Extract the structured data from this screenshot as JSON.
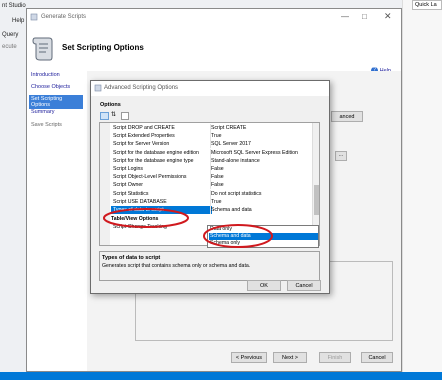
{
  "background_app": {
    "title_fragment": "nt Studio",
    "menu_help": "Help",
    "menu_query": "Query",
    "menu_execute": "ecute",
    "right_title": "Quick La"
  },
  "wizard": {
    "title": "Generate Scripts",
    "heading": "Set Scripting Options",
    "help": "Help",
    "nav": [
      {
        "label": "Introduction",
        "selected": false
      },
      {
        "label": "Choose Objects",
        "selected": false
      },
      {
        "label": "Set Scripting Options",
        "selected": true
      },
      {
        "label": "Summary",
        "selected": false
      },
      {
        "label": "Save Scripts",
        "selected": false
      }
    ],
    "advanced_button_fragment": "anced",
    "buttons": {
      "previous": "< Previous",
      "next": "Next >",
      "finish": "Finish",
      "cancel": "Cancel"
    }
  },
  "dialog": {
    "title": "Advanced Scripting Options",
    "options_label": "Options",
    "rows": [
      {
        "name": "Script DROP and CREATE",
        "value": "Script CREATE"
      },
      {
        "name": "Script Extended Properties",
        "value": "True"
      },
      {
        "name": "Script for Server Version",
        "value": "SQL Server 2017"
      },
      {
        "name": "Script for the database engine edition",
        "value": "Microsoft SQL Server Express Edition"
      },
      {
        "name": "Script for the database engine type",
        "value": "Stand-alone instance"
      },
      {
        "name": "Script Logins",
        "value": "False"
      },
      {
        "name": "Script Object-Level Permissions",
        "value": "False"
      },
      {
        "name": "Script Owner",
        "value": "False"
      },
      {
        "name": "Script Statistics",
        "value": "Do not script statistics"
      },
      {
        "name": "Script USE DATABASE",
        "value": "True"
      },
      {
        "name": "Types of data to script",
        "value": "Schema and data"
      }
    ],
    "section_table_view": "Table/View Options",
    "row_after_section": "Script Change Tracking",
    "dropdown_options": [
      "Data only",
      "Schema and data",
      "Schema only"
    ],
    "dropdown_selected": "Schema and data",
    "description_title": "Types of data to script",
    "description_text": "Generates script that contains schema only or schema and data.",
    "ok": "OK",
    "cancel": "Cancel"
  },
  "colors": {
    "selection": "#0078d7",
    "annotation_red": "#d0191e",
    "nav_selected": "#3b7fd8"
  }
}
